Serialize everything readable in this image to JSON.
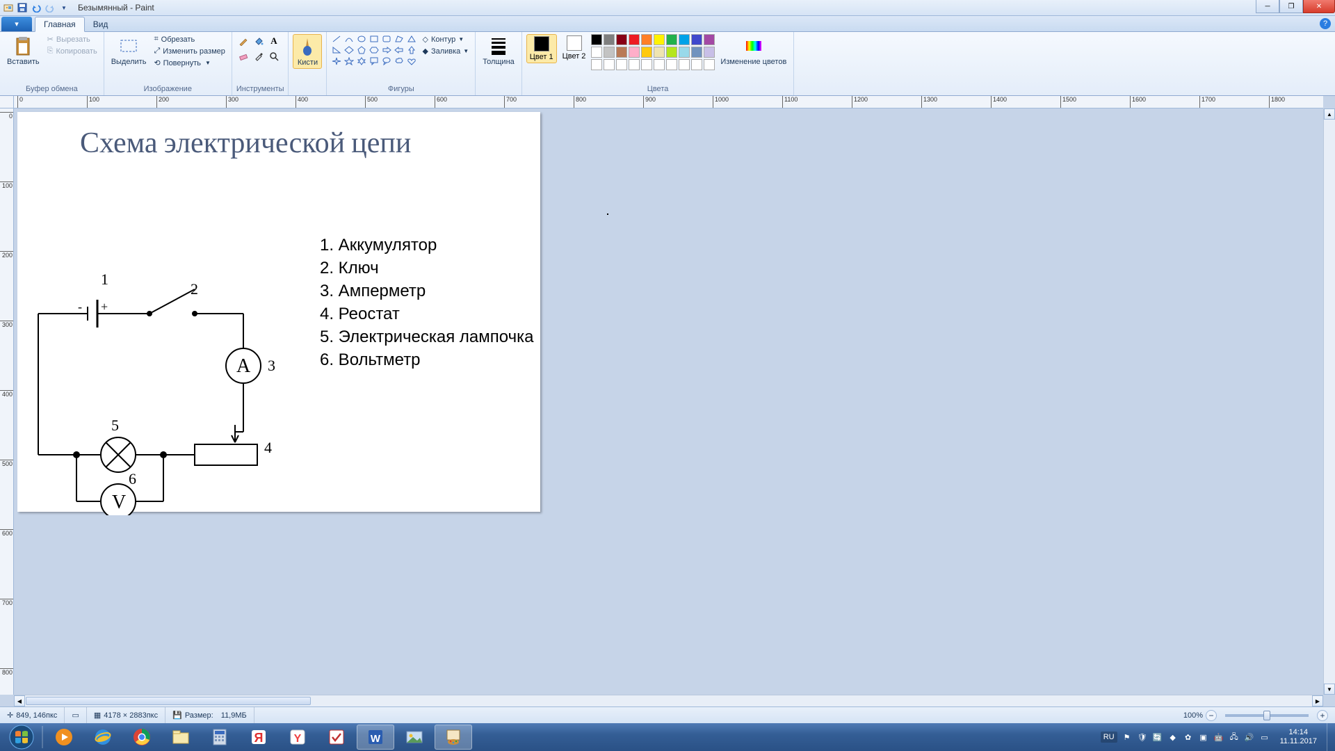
{
  "title": "Безымянный - Paint",
  "tabs": {
    "file_dropdown": "▾",
    "home": "Главная",
    "view": "Вид"
  },
  "ribbon": {
    "clipboard": {
      "paste": "Вставить",
      "cut": "Вырезать",
      "copy": "Копировать",
      "label": "Буфер обмена"
    },
    "image": {
      "select": "Выделить",
      "crop": "Обрезать",
      "resize": "Изменить размер",
      "rotate": "Повернуть",
      "label": "Изображение"
    },
    "tools": {
      "label": "Инструменты"
    },
    "brushes": {
      "label": "Кисти"
    },
    "shapes": {
      "outline": "Контур",
      "fill": "Заливка",
      "label": "Фигуры"
    },
    "size": {
      "label": "Толщина"
    },
    "colors": {
      "color1": "Цвет 1",
      "color2": "Цвет 2",
      "edit": "Изменение цветов",
      "label": "Цвета"
    }
  },
  "palette_row1": [
    "#000000",
    "#7f7f7f",
    "#880015",
    "#ed1c24",
    "#ff7f27",
    "#fff200",
    "#22b14c",
    "#00a2e8",
    "#3f48cc",
    "#a349a4"
  ],
  "palette_row2": [
    "#ffffff",
    "#c3c3c3",
    "#b97a57",
    "#ffaec9",
    "#ffc90e",
    "#efe4b0",
    "#b5e61d",
    "#99d9ea",
    "#7092be",
    "#c8bfe7"
  ],
  "palette_row3": [
    "#ffffff",
    "#ffffff",
    "#ffffff",
    "#ffffff",
    "#ffffff",
    "#ffffff",
    "#ffffff",
    "#ffffff",
    "#ffffff",
    "#ffffff"
  ],
  "canvas": {
    "title": "Схема электрической цепи",
    "legend": [
      "1. Аккумулятор",
      "2. Ключ",
      "3. Амперметр",
      "4. Реостат",
      "5. Электрическая лампочка",
      "6. Вольтметр"
    ],
    "labels": {
      "n1": "1",
      "n2": "2",
      "n3": "3",
      "n4": "4",
      "n5": "5",
      "n6": "6",
      "A": "A",
      "V": "V",
      "minus": "-",
      "plus": "+"
    }
  },
  "ruler_h": [
    "0",
    "100",
    "200",
    "300",
    "400",
    "500",
    "600",
    "700",
    "800",
    "900",
    "1000",
    "1100",
    "1200",
    "1300",
    "1400",
    "1500",
    "1600",
    "1700",
    "1800"
  ],
  "ruler_v": [
    "0",
    "100",
    "200",
    "300",
    "400",
    "500",
    "600",
    "700",
    "800"
  ],
  "status": {
    "cursor": "849, 146пкс",
    "dims": "4178 × 2883пкс",
    "size_label": "Размер:",
    "size": "11,9МБ",
    "zoom": "100%"
  },
  "tray": {
    "lang": "RU",
    "time": "14:14",
    "date": "11.11.2017"
  }
}
